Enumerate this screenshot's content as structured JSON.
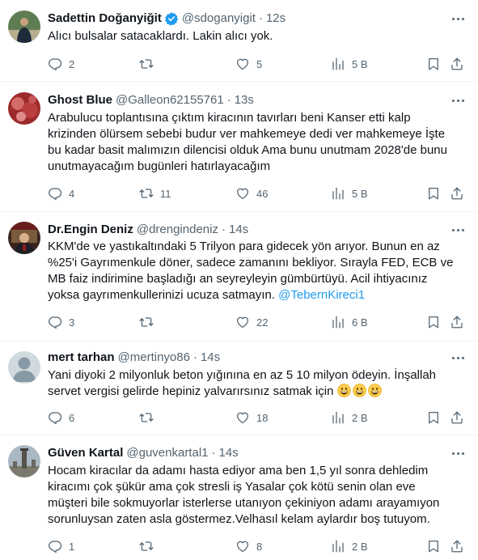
{
  "tweets": [
    {
      "name": "Sadettin Doğanyiğit",
      "handle": "@sdoganyigit",
      "time": "12s",
      "verified": true,
      "lines": [
        "Alıcı bulsalar satacaklardı. Lakin alıcı yok."
      ],
      "link": "",
      "replies": "2",
      "retweets": "",
      "likes": "5",
      "views": "5 B"
    },
    {
      "name": "Ghost Blue",
      "handle": "@Galleon62155761",
      "time": "13s",
      "verified": false,
      "lines": [
        "Arabulucu toplantısına çıktım kiracının tavırları beni Kanser etti kalp",
        "krizinden ölürsem sebebi budur ver mahkemeye dedi ver mahkemeye İşte",
        "bu kadar basit malımızın dilencisi olduk Ama bunu unutmam 2028'de bunu",
        "unutmayacağım bugünleri hatırlayacağım"
      ],
      "link": "",
      "replies": "4",
      "retweets": "11",
      "likes": "46",
      "views": "5 B"
    },
    {
      "name": "Dr.Engin Deniz",
      "handle": "@drengindeniz",
      "time": "14s",
      "verified": false,
      "lines": [
        "KKM'de ve yastıkaltındaki 5 Trilyon para gidecek yön arıyor. Bunun en az",
        "%25'i Gayrımenkule döner, sadece zamanını bekliyor. Sırayla FED, ECB ve",
        "MB faiz indirimine başladığı an seyreyleyin gümbürtüyü. Acil ihtiyacınız",
        "yoksa gayrımenkullerinizi ucuza satmayın. "
      ],
      "link": "@TebernKireci1",
      "replies": "3",
      "retweets": "",
      "likes": "22",
      "views": "6 B"
    },
    {
      "name": "mert tarhan",
      "handle": "@mertinyo86",
      "time": "14s",
      "verified": false,
      "lines": [
        "Yani diyoki 2 milyonluk beton yığınına en az 5 10 milyon ödeyin. İnşallah",
        "servet vergisi gelirde hepiniz yalvarırsınız satmak için "
      ],
      "link": "",
      "replies": "6",
      "retweets": "",
      "likes": "18",
      "views": "2 B"
    },
    {
      "name": "Güven Kartal",
      "handle": "@guvenkartal1",
      "time": "14s",
      "verified": false,
      "lines": [
        "Hocam kiracılar da adamı hasta ediyor ama ben 1,5 yıl sonra dehledim",
        "kiracımı çok şükür ama çok stresli iş Yasalar çok kötü senin olan eve",
        "müşteri bile sokmuyorlar isterlerse utanıyon çekiniyon adamı arayamıyon",
        "sorunluysan zaten asla göstermez.Velhasıl kelam aylardır boş tutuyom."
      ],
      "link": "",
      "replies": "1",
      "retweets": "",
      "likes": "8",
      "views": "2 B"
    }
  ],
  "icons": {
    "reply": "reply-icon",
    "retweet": "retweet-icon",
    "like": "heart-icon",
    "views": "views-chart-icon",
    "bookmark": "bookmark-icon",
    "share": "share-icon",
    "more": "more-dots-icon",
    "verified": "verified-badge-icon",
    "emoji": "grinning-face-emoji"
  },
  "colors": {
    "text": "#0f1419",
    "secondary": "#536471",
    "link": "#1d9bf0",
    "border": "#eff3f4",
    "verified": "#1d9bf0"
  }
}
